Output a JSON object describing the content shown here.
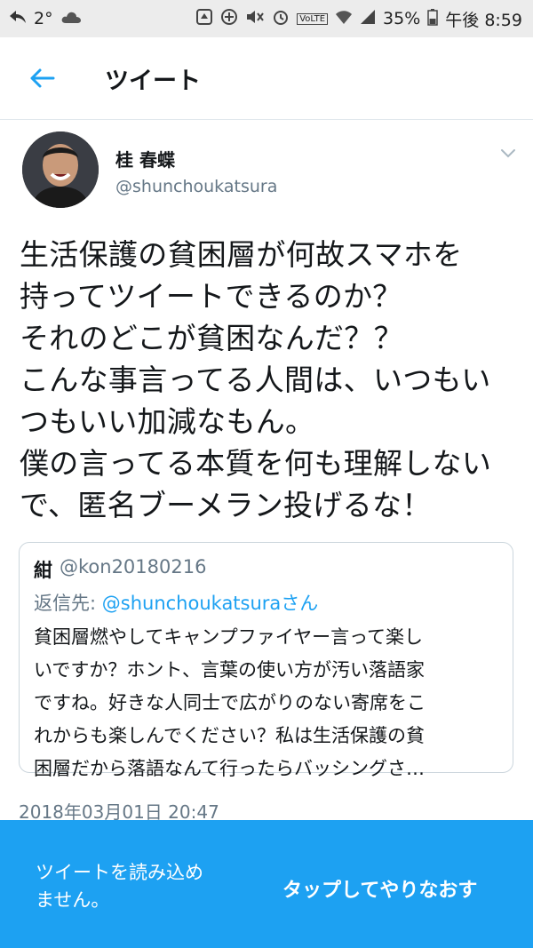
{
  "status_bar": {
    "temperature": "2°",
    "battery": "35%",
    "time": "午後 8:59",
    "volte": "VoLTE"
  },
  "header": {
    "title": "ツイート"
  },
  "tweet": {
    "author_name": "桂 春蝶",
    "author_handle": "@shunchoukatsura",
    "text_lines": [
      "生活保護の貧困層が何故スマホを",
      "持ってツイートできるのか？",
      "それのどこが貧困なんだ？？",
      "こんな事言ってる人間は、いつもい",
      "つもいい加減なもん。",
      "僕の言ってる本質を何も理解しない",
      "で、匿名ブーメラン投げるな！"
    ],
    "timestamp": "2018年03月01日 20:47"
  },
  "quoted_tweet": {
    "author_name": "紺",
    "author_handle": "@kon20180216",
    "reply_prefix": "返信先: ",
    "reply_to": "@shunchoukatsuraさん",
    "text_lines": [
      "貧困層燃やしてキャンプファイヤー言って楽し",
      "いですか？ホント、言葉の使い方が汚い落語家",
      "ですね。好きな人同士で広がりのない寄席をこ",
      "れからも楽しんでください？私は生活保護の貧",
      "困層だから落語なんて行ったらバッシングさ…"
    ]
  },
  "banner": {
    "message_line1": "ツイートを読み込め",
    "message_line2": "ません。",
    "retry_label": "タップしてやりなおす"
  },
  "colors": {
    "accent": "#1da1f2",
    "secondary_text": "#657786",
    "primary_text": "#14171a"
  }
}
